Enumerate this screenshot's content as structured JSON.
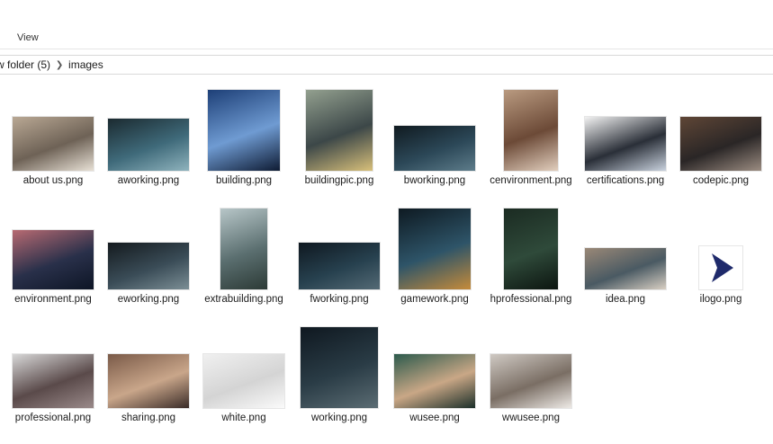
{
  "ribbon": {
    "view_tab": "View"
  },
  "address": {
    "parent": "w folder (5)",
    "current": "images"
  },
  "files": [
    {
      "name": "about us.png",
      "colors": [
        "#b9a894",
        "#6e6256",
        "#e8e1d6"
      ]
    },
    {
      "name": "aworking.png",
      "colors": [
        "#1b2a30",
        "#3f6a7a",
        "#8fb3bd"
      ]
    },
    {
      "name": "building.png",
      "colors": [
        "#1d3f77",
        "#6f9bd2",
        "#0e1b33"
      ]
    },
    {
      "name": "buildingpic.png",
      "colors": [
        "#93a08f",
        "#3c4748",
        "#d8c07a"
      ]
    },
    {
      "name": "bworking.png",
      "colors": [
        "#101a20",
        "#2c4858",
        "#5d7c8a"
      ]
    },
    {
      "name": "cenvironment.png",
      "colors": [
        "#b99a80",
        "#6c4a37",
        "#e2cfbe"
      ]
    },
    {
      "name": "certifications.png",
      "colors": [
        "#f2f2f2",
        "#2a2f38",
        "#c9d2de"
      ]
    },
    {
      "name": "codepic.png",
      "colors": [
        "#5f4636",
        "#2a2626",
        "#9c8d82"
      ]
    },
    {
      "name": "environment.png",
      "colors": [
        "#b86a72",
        "#29304a",
        "#0d1525"
      ]
    },
    {
      "name": "eworking.png",
      "colors": [
        "#141a1e",
        "#3a4c57",
        "#7b8e95"
      ]
    },
    {
      "name": "extrabuilding.png",
      "colors": [
        "#b7c6c8",
        "#5b6f70",
        "#2c3a36"
      ]
    },
    {
      "name": "fworking.png",
      "colors": [
        "#0f1820",
        "#27414f",
        "#546a75"
      ]
    },
    {
      "name": "gamework.png",
      "colors": [
        "#0e1a22",
        "#2e5468",
        "#c58b3a"
      ]
    },
    {
      "name": "hprofessional.png",
      "colors": [
        "#1b2b22",
        "#2f4a3a",
        "#0c1510"
      ]
    },
    {
      "name": "idea.png",
      "colors": [
        "#9a8877",
        "#4a5a63",
        "#d8cfc3"
      ]
    },
    {
      "name": "ilogo.png",
      "colors": [
        "#ffffff",
        "#1f2a6b",
        "#ffffff"
      ]
    },
    {
      "name": "professional.png",
      "colors": [
        "#d8d8d8",
        "#5a4a4a",
        "#9a8a8a"
      ]
    },
    {
      "name": "sharing.png",
      "colors": [
        "#7a5a48",
        "#c9a68a",
        "#3a2c28"
      ]
    },
    {
      "name": "white.png",
      "colors": [
        "#f0f0f0",
        "#d4d4d4",
        "#fafafa"
      ]
    },
    {
      "name": "working.png",
      "colors": [
        "#0f1820",
        "#2a3c46",
        "#5b6c73"
      ]
    },
    {
      "name": "wusee.png",
      "colors": [
        "#2c5a4c",
        "#c9a786",
        "#1b2f29"
      ]
    },
    {
      "name": "wwusee.png",
      "colors": [
        "#cfc9c3",
        "#7a6e64",
        "#eeeae6"
      ]
    }
  ],
  "scroll": {
    "first_visible_row": 1
  }
}
